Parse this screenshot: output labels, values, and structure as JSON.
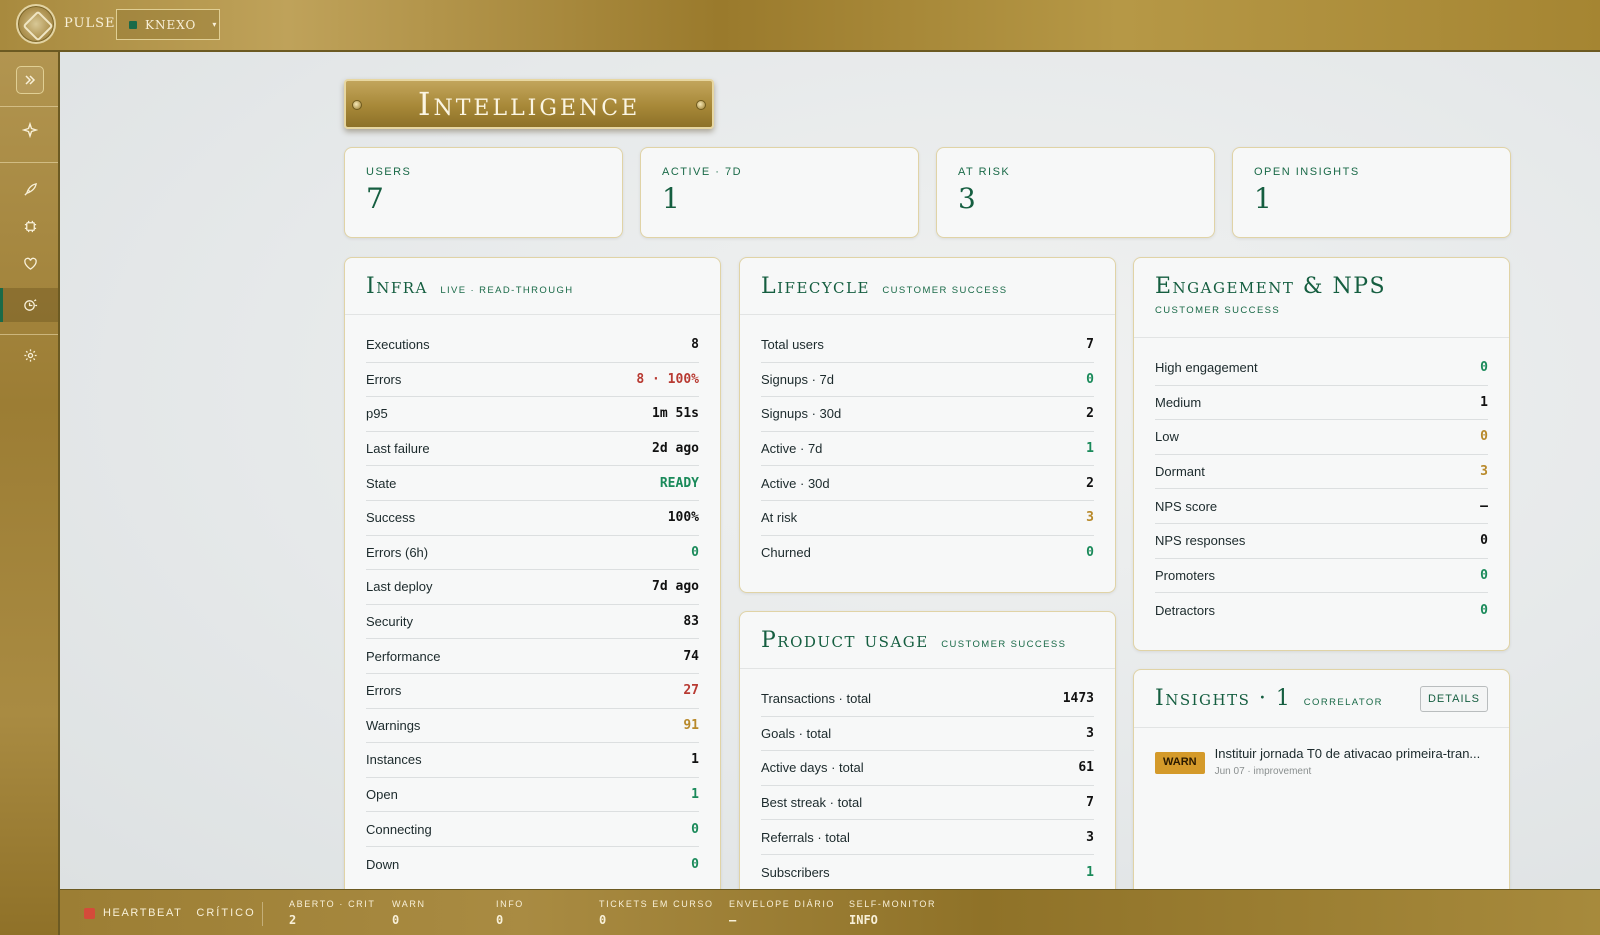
{
  "app": {
    "brand": "PULSE",
    "workspace": "KNEXO"
  },
  "sidebar": {
    "items": [
      {
        "icon": "expand-icon"
      },
      {
        "icon": "sparkle-icon"
      },
      {
        "icon": "rocket-icon"
      },
      {
        "icon": "chip-icon"
      },
      {
        "icon": "heart-icon"
      },
      {
        "icon": "insight-icon",
        "active": true
      },
      {
        "icon": "gear-icon"
      }
    ]
  },
  "page": {
    "title": "Intelligence"
  },
  "kpis": [
    {
      "label": "USERS",
      "value": "7"
    },
    {
      "label": "ACTIVE · 7D",
      "value": "1"
    },
    {
      "label": "AT RISK",
      "value": "3"
    },
    {
      "label": "OPEN INSIGHTS",
      "value": "1"
    }
  ],
  "infra": {
    "title": "Infra",
    "subtitle": "LIVE · READ-THROUGH",
    "rows": [
      {
        "label": "Executions",
        "value": "8"
      },
      {
        "label": "Errors",
        "value": "8 · 100%"
      },
      {
        "label": "p95",
        "value": "1m 51s"
      },
      {
        "label": "Last failure",
        "value": "2d ago"
      },
      {
        "label": "State",
        "value": "READY"
      },
      {
        "label": "Success",
        "value": "100%"
      },
      {
        "label": "Errors (6h)",
        "value": "0"
      },
      {
        "label": "Last deploy",
        "value": "7d ago"
      },
      {
        "label": "Security",
        "value": "83"
      },
      {
        "label": "Performance",
        "value": "74"
      },
      {
        "label": "Errors",
        "value": "27"
      },
      {
        "label": "Warnings",
        "value": "91"
      },
      {
        "label": "Instances",
        "value": "1"
      },
      {
        "label": "Open",
        "value": "1"
      },
      {
        "label": "Connecting",
        "value": "0"
      },
      {
        "label": "Down",
        "value": "0"
      }
    ]
  },
  "lifecycle": {
    "title": "Lifecycle",
    "subtitle": "CUSTOMER SUCCESS",
    "rows": [
      {
        "label": "Total users",
        "value": "7"
      },
      {
        "label": "Signups · 7d",
        "value": "0"
      },
      {
        "label": "Signups · 30d",
        "value": "2"
      },
      {
        "label": "Active · 7d",
        "value": "1"
      },
      {
        "label": "Active · 30d",
        "value": "2"
      },
      {
        "label": "At risk",
        "value": "3"
      },
      {
        "label": "Churned",
        "value": "0"
      }
    ]
  },
  "product_usage": {
    "title": "Product usage",
    "subtitle": "CUSTOMER SUCCESS",
    "rows": [
      {
        "label": "Transactions · total",
        "value": "1473"
      },
      {
        "label": "Goals · total",
        "value": "3"
      },
      {
        "label": "Active days · total",
        "value": "61"
      },
      {
        "label": "Best streak · total",
        "value": "7"
      },
      {
        "label": "Referrals · total",
        "value": "3"
      },
      {
        "label": "Subscribers",
        "value": "1"
      }
    ]
  },
  "engagement": {
    "title": "Engagement & NPS",
    "subtitle": "CUSTOMER SUCCESS",
    "rows": [
      {
        "label": "High engagement",
        "value": "0"
      },
      {
        "label": "Medium",
        "value": "1"
      },
      {
        "label": "Low",
        "value": "0"
      },
      {
        "label": "Dormant",
        "value": "3"
      },
      {
        "label": "NPS score",
        "value": "—"
      },
      {
        "label": "NPS responses",
        "value": "0"
      },
      {
        "label": "Promoters",
        "value": "0"
      },
      {
        "label": "Detractors",
        "value": "0"
      }
    ]
  },
  "insights": {
    "title": "Insights · 1",
    "subtitle": "CORRELATOR",
    "details_label": "DETAILS",
    "items": [
      {
        "badge": "WARN",
        "title": "Instituir jornada T0 de ativacao primeira-tran...",
        "meta": "Jun 07 · improvement"
      }
    ]
  },
  "footer": {
    "heartbeat_label": "HEARTBEAT",
    "heartbeat_status": "CRÍTICO",
    "stats": [
      {
        "label": "ABERTO · CRIT",
        "value": "2"
      },
      {
        "label": "WARN",
        "value": "0"
      },
      {
        "label": "INFO",
        "value": "0"
      },
      {
        "label": "TICKETS EM CURSO",
        "value": "0"
      },
      {
        "label": "ENVELOPE DIÁRIO",
        "value": "—"
      },
      {
        "label": "SELF-MONITOR",
        "value": "INFO"
      }
    ]
  },
  "colors": {
    "gold": "#a88a3e",
    "green": "#155e40",
    "red": "#b83a32",
    "amber": "#b8892a",
    "success": "#1a8a5a"
  }
}
